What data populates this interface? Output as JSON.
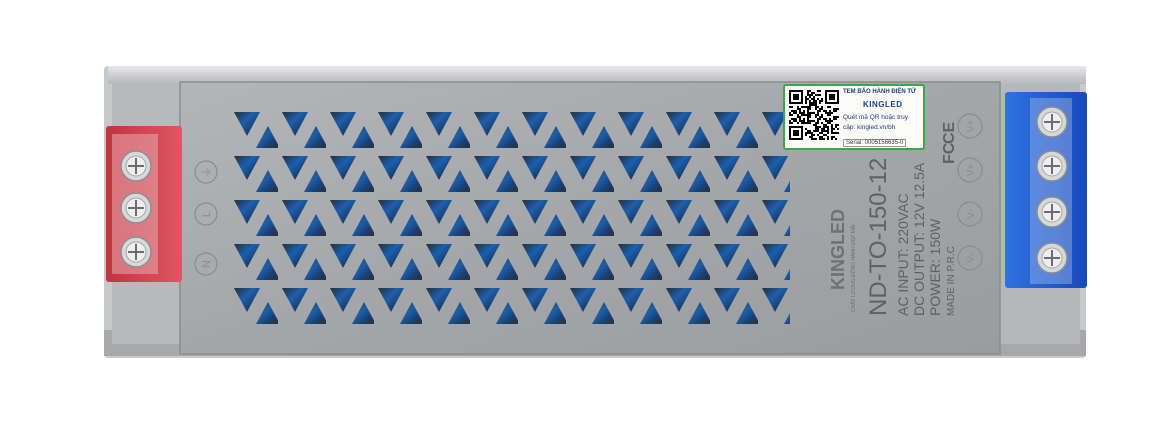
{
  "product": {
    "brand": "KINGLED",
    "tagline": "CHẤT LƯỢNG ĐỒNG HÀNH ĐẸP MÃI",
    "model": "ND-TO-150-12",
    "ac_input": "AC INPUT: 220VAC",
    "dc_output": "DC OUTPUT: 12V  12.5A",
    "power": "POWER: 150W",
    "made_in": "MADE IN P.R.C",
    "certifications": [
      "CE",
      "FC"
    ]
  },
  "terminals": {
    "input_labels": [
      "N",
      "L",
      "⏚"
    ],
    "output_labels": [
      "V+",
      "V+",
      "V-",
      "V-"
    ],
    "input_color": "#d9424f",
    "output_color": "#1f5fd6"
  },
  "sticker": {
    "title": "TEM BẢO HÀNH ĐIỆN TỬ",
    "brand": "KINGLED",
    "line1": "Quét mã QR hoặc truy",
    "line2": "cập: kingled.vn/bh",
    "serial": "Serial: 0005156635-0",
    "border_color": "#3aa84a"
  },
  "colors": {
    "housing": "#a9abae",
    "housing_dark": "#8d9093",
    "interior_blue": "#1d6fc4"
  }
}
